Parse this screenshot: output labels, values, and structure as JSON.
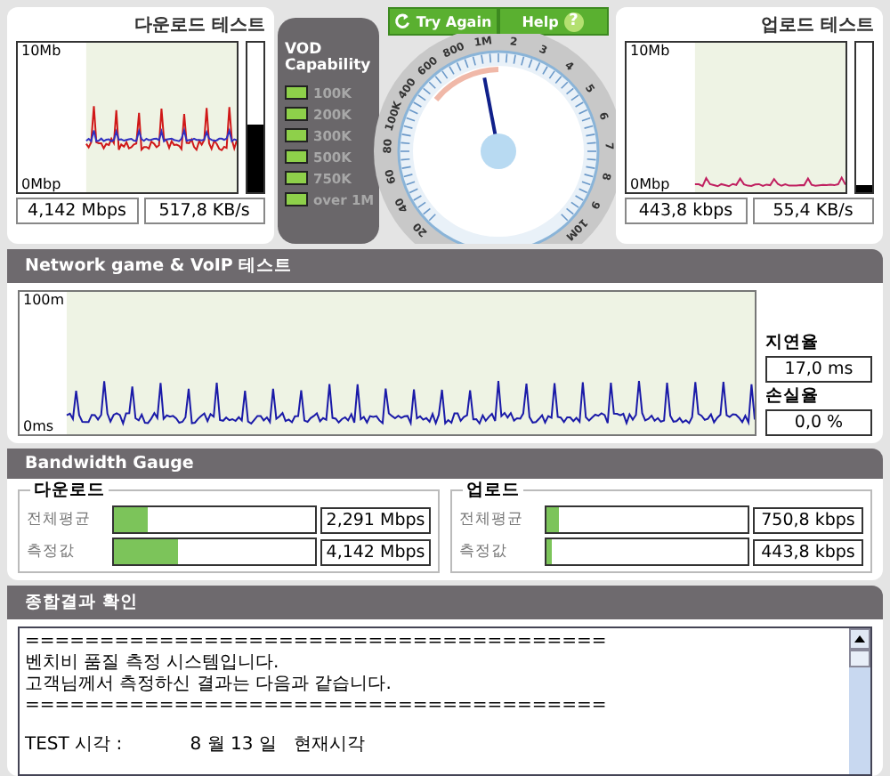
{
  "download_test": {
    "title": "다운로드 테스트",
    "y_max": "10Mb",
    "y_min": "0Mbp",
    "meter": {
      "level": 0.45
    },
    "readings": [
      "4,142 Mbps",
      "517,8 KB/s"
    ]
  },
  "vod": {
    "title": "VOD Capability",
    "items": [
      {
        "label": "100K",
        "on": true
      },
      {
        "label": "200K",
        "on": true
      },
      {
        "label": "300K",
        "on": true
      },
      {
        "label": "500K",
        "on": true
      },
      {
        "label": "750K",
        "on": true
      },
      {
        "label": "over 1M",
        "on": true
      }
    ]
  },
  "gauge": {
    "buttons": [
      "Try Again",
      "Help"
    ],
    "help_icon": "?",
    "level": 0.46,
    "tick_labels": [
      "20",
      "40",
      "60",
      "80",
      "100K",
      "400",
      "600",
      "800",
      "1M",
      "2",
      "3",
      "4",
      "5",
      "6",
      "7",
      "8",
      "9",
      "10M"
    ]
  },
  "upload_test": {
    "title": "업로드 테스트",
    "y_max": "10Mb",
    "y_min": "0Mbp",
    "meter": {
      "level": 0.05
    },
    "readings": [
      "443,8 kbps",
      "55,4 KB/s"
    ]
  },
  "voip": {
    "title": "Network game & VoIP 테스트",
    "y_max": "100m",
    "y_min": "0ms",
    "delay_label": "지연율",
    "delay": "17,0 ms",
    "loss_label": "손실율",
    "loss": "0,0 %"
  },
  "bandwidth": {
    "title": "Bandwidth Gauge",
    "groups": [
      {
        "title": "다운로드",
        "rows": [
          {
            "label": "전체평균",
            "level": 0.17,
            "value": "2,291 Mbps"
          },
          {
            "label": "측정값",
            "level": 0.32,
            "value": "4,142 Mbps"
          }
        ]
      },
      {
        "title": "업로드",
        "rows": [
          {
            "label": "전체평균",
            "level": 0.06,
            "value": "750,8 kbps"
          },
          {
            "label": "측정값",
            "level": 0.03,
            "value": "443,8 kbps"
          }
        ]
      }
    ]
  },
  "summary": {
    "title": "종합결과 확인",
    "lines": [
      "=======================================",
      "벤치비 품질 측정 시스템입니다.",
      "고객님께서 측정하신 결과는 다음과 같습니다.",
      "=======================================",
      "TEST 시각 :            8 월 13 일   현재시각"
    ]
  }
}
